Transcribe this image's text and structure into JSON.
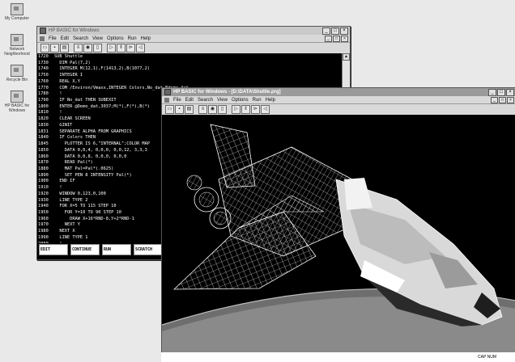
{
  "desktop": {
    "icons": [
      {
        "label": "My Computer"
      },
      {
        "label": "Network Neighborhood"
      },
      {
        "label": "Recycle Bin"
      },
      {
        "label": "HP BASIC for Windows"
      }
    ]
  },
  "editor_window": {
    "title": "HP BASIC for Windows",
    "menu": [
      "File",
      "Edit",
      "Search",
      "View",
      "Options",
      "Run",
      "Help"
    ],
    "lines": [
      {
        "n": "1720",
        "code": "SUB Shuttle"
      },
      {
        "n": "1730",
        "code": "  DIM Pal(7,2)"
      },
      {
        "n": "1740",
        "code": "  INTEGER M(12,1),F(1413,2),B(1077,2)"
      },
      {
        "n": "1750",
        "code": "  INTEGER I"
      },
      {
        "n": "1760",
        "code": "  REAL X,Y"
      },
      {
        "n": "1770",
        "code": "  COM /Environ/Vmaxx,INTEGER Colors,No_dat,Ndemo_dat"
      },
      {
        "n": "1780",
        "code": "  !"
      },
      {
        "n": "1790",
        "code": "  IF No_dat THEN SUBEXIT"
      },
      {
        "n": "1800",
        "code": "  ENTER @Demo_dat,3037;M(*),F(*),B(*)"
      },
      {
        "n": "1810",
        "code": "  !"
      },
      {
        "n": "1820",
        "code": "  CLEAR SCREEN"
      },
      {
        "n": "1830",
        "code": "  GINIT"
      },
      {
        "n": "1831",
        "code": "  SEPARATE ALPHA FROM GRAPHICS"
      },
      {
        "n": "1840",
        "code": "  IF Colors THEN"
      },
      {
        "n": "1845",
        "code": "    PLOTTER IS 6,\"INTERNAL\";COLOR MAP"
      },
      {
        "n": "1850",
        "code": "    DATA 0,0,4, 0,0,0, 0,0,12, 3,3,3"
      },
      {
        "n": "1860",
        "code": "    DATA 0,0,8, 0,0,0, 0,0,0"
      },
      {
        "n": "1870",
        "code": "    READ Pal(*)"
      },
      {
        "n": "1880",
        "code": "    MAT Pal=Pal*(.0625)"
      },
      {
        "n": "1890",
        "code": "    SET PEN 8 INTENSITY Pal(*)"
      },
      {
        "n": "1900",
        "code": "  END IF"
      },
      {
        "n": "1910",
        "code": "  !"
      },
      {
        "n": "1920",
        "code": "  WINDOW 0,123,0,100"
      },
      {
        "n": "1930",
        "code": "  LINE TYPE 2"
      },
      {
        "n": "1940",
        "code": "  FOR X=5 TO 115 STEP 10"
      },
      {
        "n": "1950",
        "code": "    FOR Y=10 TO 90 STEP 10"
      },
      {
        "n": "1960",
        "code": "      DRAW X+16*RND-8,Y+2*RND-1"
      },
      {
        "n": "1970",
        "code": "    NEXT Y"
      },
      {
        "n": "1980",
        "code": "  NEXT X"
      },
      {
        "n": "1990",
        "code": "  LINE TYPE 1"
      },
      {
        "n": "2000",
        "code": "  !"
      },
      {
        "n": "2010",
        "code": "  FOR I=15 TO 2 STEP -1"
      }
    ],
    "softkeys": [
      "EDIT",
      "CONTINUE",
      "RUN",
      "SCRATCH"
    ]
  },
  "graphics_window": {
    "title": "HP BASIC for Windows - [D:\\DATA\\Shuttle.prg]",
    "menu": [
      "File",
      "Edit",
      "Search",
      "View",
      "Options",
      "Run",
      "Help"
    ]
  },
  "statusbar": {
    "indicators": "CAP  NUM"
  }
}
